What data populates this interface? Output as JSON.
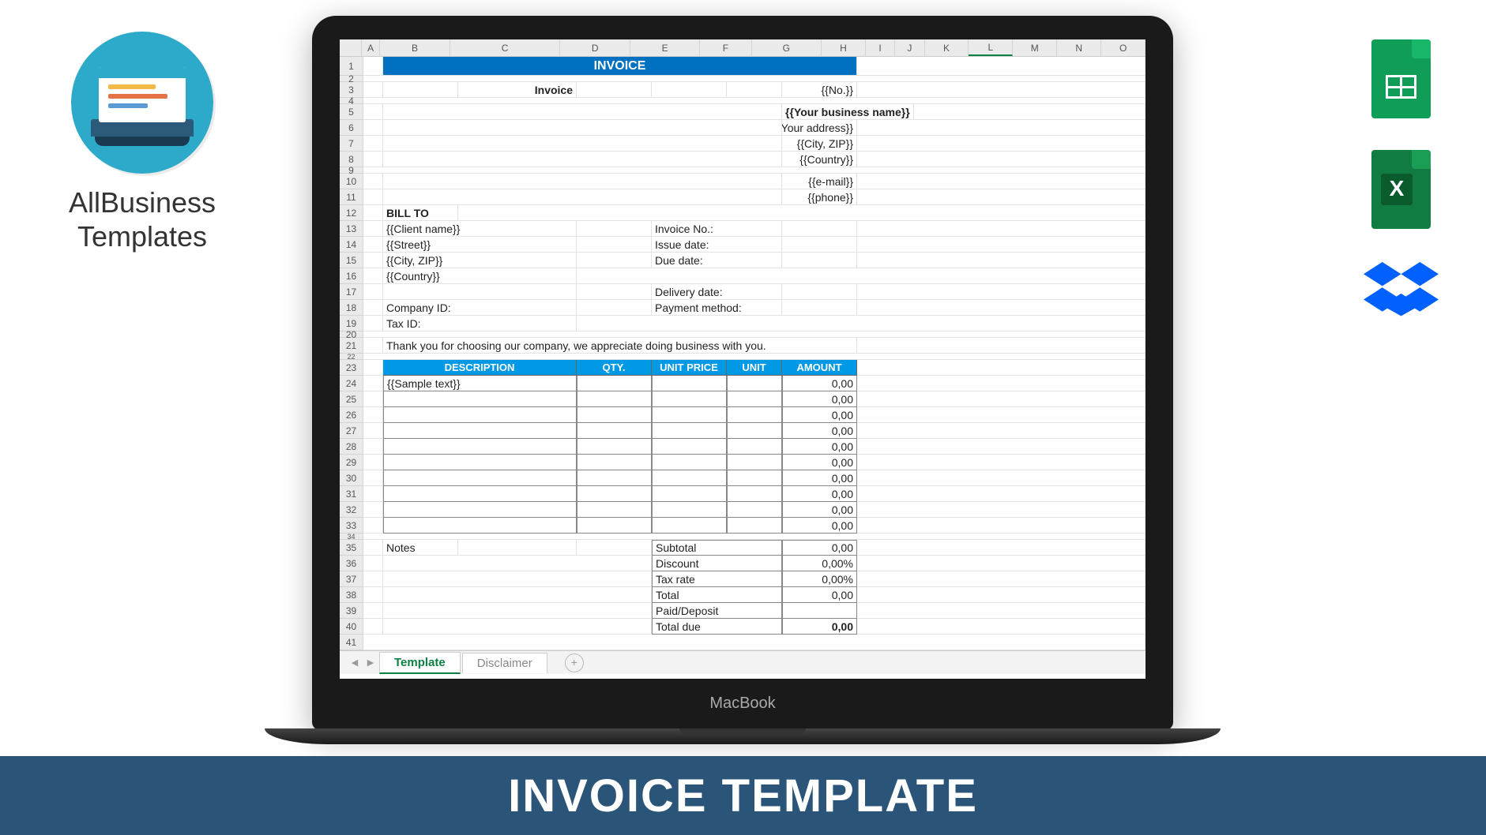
{
  "logo": {
    "line1": "AllBusiness",
    "line2": "Templates"
  },
  "banner": "INVOICE TEMPLATE",
  "laptop_brand": "MacBook",
  "tabs": {
    "active": "Template",
    "inactive": "Disclaimer"
  },
  "columns": [
    "A",
    "B",
    "C",
    "D",
    "E",
    "F",
    "G",
    "H",
    "I",
    "J",
    "K",
    "L",
    "M",
    "N",
    "O"
  ],
  "invoice": {
    "title": "INVOICE",
    "label_invoice": "Invoice",
    "no": "{{No.}}",
    "from": {
      "business": "{{Your business name}}",
      "address": "{{Your address}}",
      "city": "{{City, ZIP}}",
      "country": "{{Country}}",
      "email": "{{e-mail}}",
      "phone": "{{phone}}"
    },
    "bill_to_label": "BILL TO",
    "bill_to": {
      "client": "{{Client name}}",
      "street": "{{Street}}",
      "city": "{{City, ZIP}}",
      "country": "{{Country}}"
    },
    "meta": {
      "invoice_no": "Invoice No.:",
      "issue_date": "Issue date:",
      "due_date": "Due date:",
      "delivery_date": "Delivery date:",
      "payment_method": "Payment method:"
    },
    "company_id": "Company ID:",
    "tax_id": "Tax ID:",
    "thanks": "Thank you for choosing our company, we appreciate doing business with you.",
    "headers": {
      "desc": "DESCRIPTION",
      "qty": "QTY.",
      "price": "UNIT PRICE",
      "unit": "UNIT",
      "amount": "AMOUNT"
    },
    "sample": "{{Sample text}}",
    "amount_default": "0,00",
    "notes": "Notes",
    "summary": {
      "subtotal": {
        "label": "Subtotal",
        "value": "0,00"
      },
      "discount": {
        "label": "Discount",
        "value": "0,00%"
      },
      "tax": {
        "label": "Tax rate",
        "value": "0,00%"
      },
      "total": {
        "label": "Total",
        "value": "0,00"
      },
      "paid": {
        "label": "Paid/Deposit",
        "value": ""
      },
      "due": {
        "label": "Total due",
        "value": "0,00"
      }
    }
  }
}
